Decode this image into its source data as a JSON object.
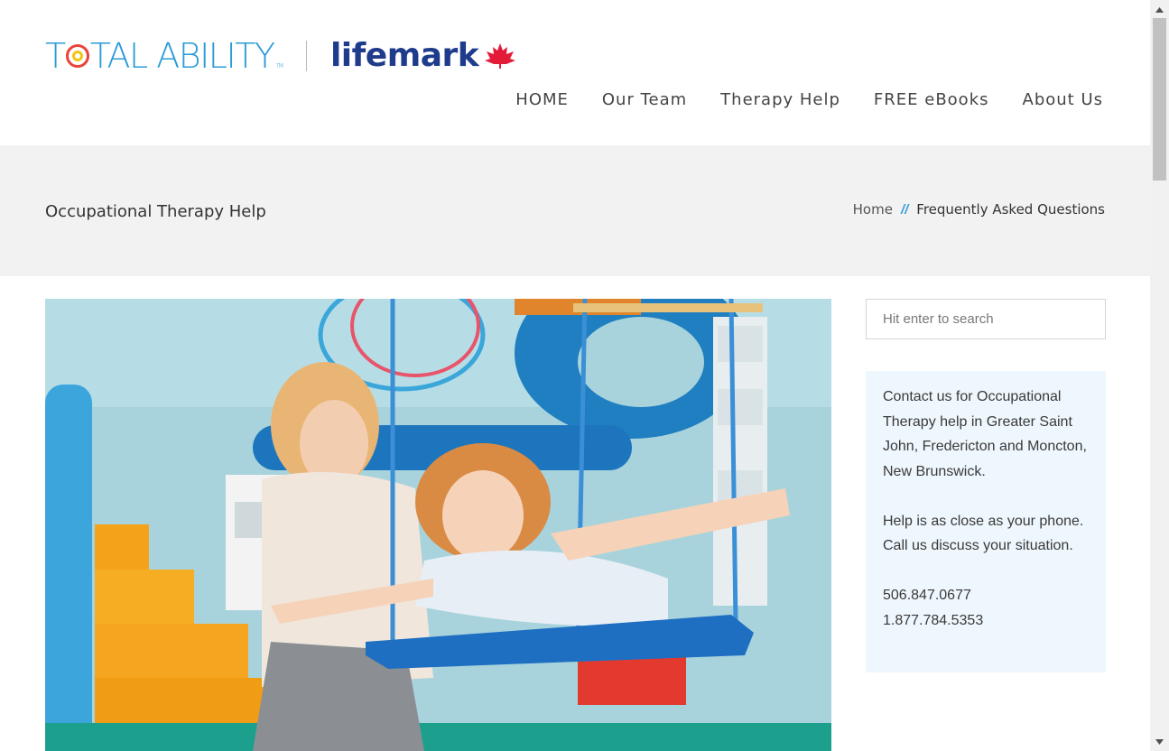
{
  "logo": {
    "total_ability_text_a": "T",
    "total_ability_text_b": "TAL ABILITY",
    "total_ability_tm": "TM",
    "lifemark_text": "lifemark"
  },
  "nav": {
    "items": [
      {
        "label": "HOME"
      },
      {
        "label": "Our Team"
      },
      {
        "label": "Therapy Help"
      },
      {
        "label": "FREE eBooks"
      },
      {
        "label": "About Us"
      }
    ]
  },
  "page": {
    "title": "Occupational Therapy Help"
  },
  "breadcrumb": {
    "home": "Home",
    "separator": "//",
    "current": "Frequently Asked Questions"
  },
  "search": {
    "placeholder": "Hit enter to search"
  },
  "contact": {
    "paragraph1": "Contact us for Occupational Therapy help in Greater Saint John, Fredericton and Moncton, New Brunswick.",
    "paragraph2": "Help is as close as your phone. Call us discuss your situation.",
    "phone1": "506.847.0677",
    "phone2": "1.877.784.5353"
  },
  "colors": {
    "brand_blue": "#2b9bd6",
    "lifemark_navy": "#1f3c8c",
    "lifemark_red": "#e31b38",
    "breadcrumb_accent": "#3aa0d8",
    "sidebar_bg": "#eef7fd"
  }
}
